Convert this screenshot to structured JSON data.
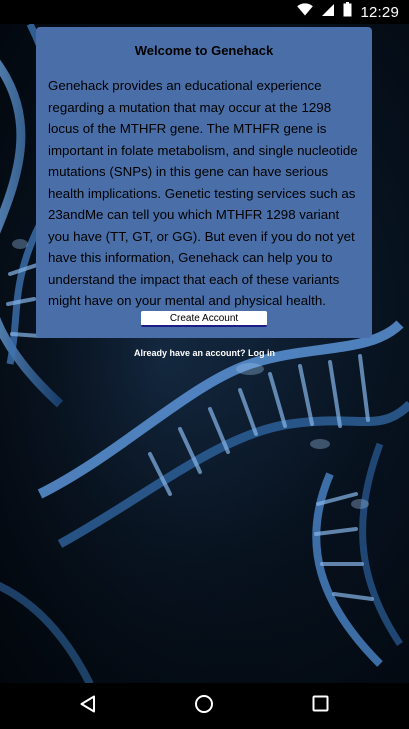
{
  "status_bar": {
    "time": "12:29",
    "icons": [
      "wifi-icon",
      "signal-icon",
      "battery-icon"
    ]
  },
  "welcome": {
    "title": "Welcome to Genehack",
    "body": "Genehack provides an educational experience regarding a mutation that may occur at the 1298 locus of the MTHFR gene. The MTHFR gene is important in folate metabolism, and single nucleotide mutations (SNPs) in this gene can have serious health implications. Genetic testing services such as 23andMe can tell you which MTHFR 1298 variant you have (TT, GT, or GG). But even if you do not yet have this information, Genehack can help you to understand the impact that each of these variants might have on your mental and physical health.",
    "create_account_label": "Create Account"
  },
  "login_link": "Already have an account? Log in",
  "nav_bar": {
    "icons": [
      "back-icon",
      "home-icon",
      "recents-icon"
    ]
  },
  "colors": {
    "card_background": "#4a6fa8",
    "button_underline": "#1d1d86",
    "status_bar": "#000000"
  }
}
